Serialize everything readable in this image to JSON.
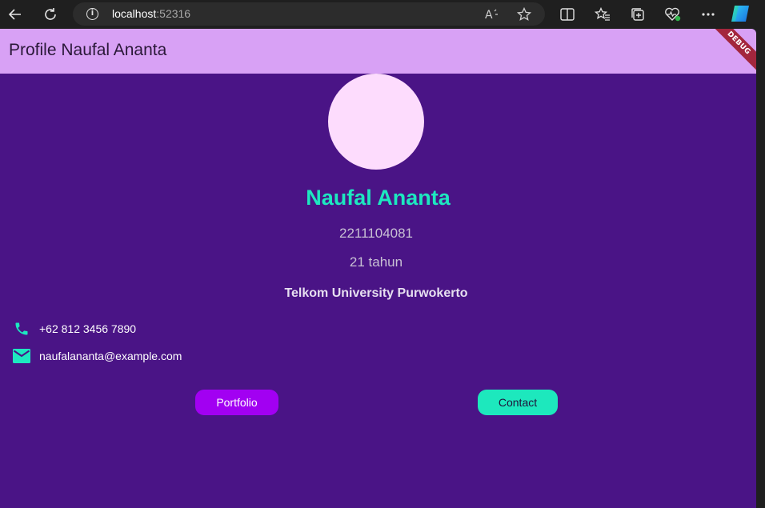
{
  "browser": {
    "url_host": "localhost",
    "url_port": ":52316"
  },
  "app": {
    "title": "Profile Naufal Ananta",
    "debug_banner": "DEBUG",
    "accent_color": "#1de8c0",
    "background_color": "#4a1486",
    "appbar_color": "#d8a1f5"
  },
  "profile": {
    "name": "Naufal Ananta",
    "nim": "2211104081",
    "age": "21 tahun",
    "campus": "Telkom University Purwokerto",
    "phone": "+62 812 3456 7890",
    "email": "naufalananta@example.com"
  },
  "buttons": {
    "portfolio_label": "Portfolio",
    "contact_label": "Contact"
  },
  "icons": {
    "phone": "phone-icon",
    "email": "mail-icon"
  }
}
